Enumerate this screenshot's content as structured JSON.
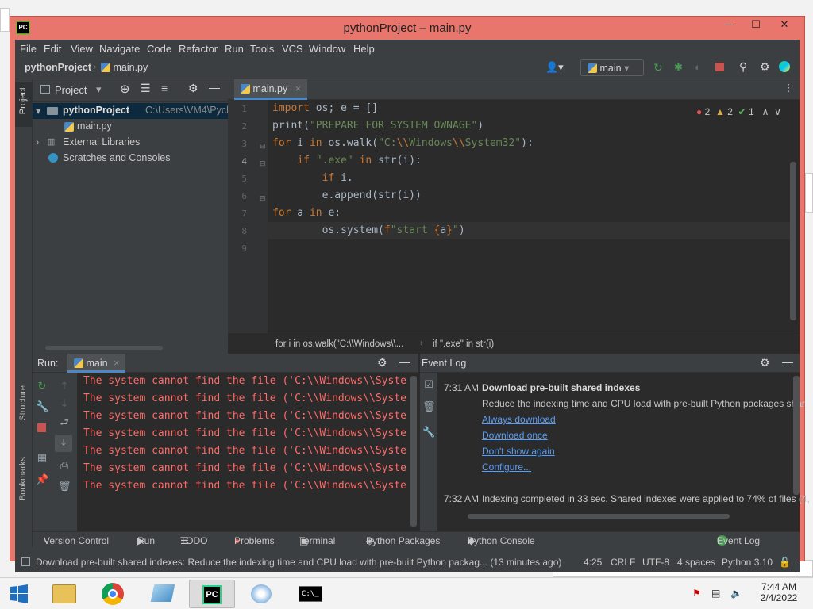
{
  "window": {
    "title": "pythonProject – main.py",
    "controls": [
      "—",
      "☐",
      "✕"
    ]
  },
  "menu": [
    "File",
    "Edit",
    "View",
    "Navigate",
    "Code",
    "Refactor",
    "Run",
    "Tools",
    "VCS",
    "Window",
    "Help"
  ],
  "navbar": {
    "project": "pythonProject",
    "file": "main.py",
    "run_config": "main"
  },
  "left_strip": {
    "project_tab": "Project",
    "structure_tab": "Structure",
    "bookmarks_tab": "Bookmarks"
  },
  "project_panel": {
    "header": "Project",
    "tree": {
      "root": "pythonProject",
      "root_path": "C:\\Users\\VM4\\Pycharm",
      "file": "main.py",
      "external": "External Libraries",
      "scratches": "Scratches and Consoles"
    }
  },
  "editor": {
    "tab": "main.py",
    "inspection": {
      "errors": "2",
      "warnings": "2",
      "ok": "1"
    },
    "line_numbers": [
      "1",
      "2",
      "3",
      "4",
      "5",
      "6",
      "7",
      "8",
      "9"
    ],
    "breadcrumb_1": "for i in os.walk(\"C:\\\\Windows\\\\...",
    "breadcrumb_2": "if \".exe\" in str(i)"
  },
  "run_panel": {
    "label": "Run:",
    "config": "main",
    "output": [
      "The system cannot find the file ('C:\\\\Windows\\\\Syste",
      "The system cannot find the file ('C:\\\\Windows\\\\Syste",
      "The system cannot find the file ('C:\\\\Windows\\\\Syste",
      "The system cannot find the file ('C:\\\\Windows\\\\Syste",
      "The system cannot find the file ('C:\\\\Windows\\\\Syste",
      "The system cannot find the file ('C:\\\\Windows\\\\Syste",
      "The system cannot find the file ('C:\\\\Windows\\\\Syste"
    ]
  },
  "event_log": {
    "title": "Event Log",
    "entry1": {
      "time": "7:31 AM",
      "heading": "Download pre-built shared indexes",
      "body": "Reduce the indexing time and CPU load with pre-built Python packages shar",
      "links": [
        "Always download",
        "Download once",
        "Don't show again",
        "Configure..."
      ]
    },
    "entry2": {
      "time": "7:32 AM",
      "body": "Indexing completed in 33 sec. Shared indexes were applied to 74% of files (4,"
    }
  },
  "bottom_tabs": [
    "Version Control",
    "Run",
    "TODO",
    "Problems",
    "Terminal",
    "Python Packages",
    "Python Console",
    "Event Log"
  ],
  "event_log_badge": "1",
  "status_bar": {
    "message": "Download pre-built shared indexes: Reduce the indexing time and CPU load with pre-built Python packag... (13 minutes ago)",
    "position": "4:25",
    "line_sep": "CRLF",
    "encoding": "UTF-8",
    "indent": "4 spaces",
    "interpreter": "Python 3.10"
  },
  "taskbar": {
    "time": "7:44 AM",
    "date": "2/4/2022",
    "pycharm": "PC"
  },
  "colors": {
    "title_bg": "#e9766c",
    "ide_bg": "#2b2b2b",
    "keyword": "#cc7832",
    "string": "#6a8759",
    "error_text": "#ff6b68",
    "link": "#589df6"
  }
}
